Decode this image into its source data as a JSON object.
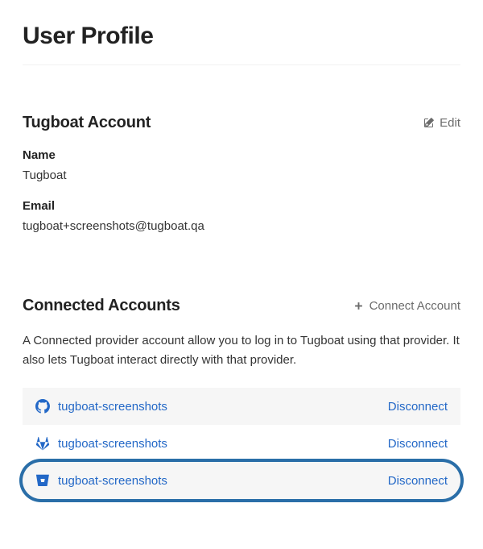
{
  "page": {
    "title": "User Profile"
  },
  "account": {
    "section_title": "Tugboat Account",
    "edit_label": "Edit",
    "name_label": "Name",
    "name_value": "Tugboat",
    "email_label": "Email",
    "email_value": "tugboat+screenshots@tugboat.qa"
  },
  "connected": {
    "section_title": "Connected Accounts",
    "connect_label": "Connect Account",
    "description": "A Connected provider account allow you to log in to Tugboat using that provider. It also lets Tugboat interact directly with that provider.",
    "disconnect_label": "Disconnect",
    "items": [
      {
        "provider": "github",
        "name": "tugboat-screenshots"
      },
      {
        "provider": "gitlab",
        "name": "tugboat-screenshots"
      },
      {
        "provider": "bitbucket",
        "name": "tugboat-screenshots"
      }
    ]
  }
}
